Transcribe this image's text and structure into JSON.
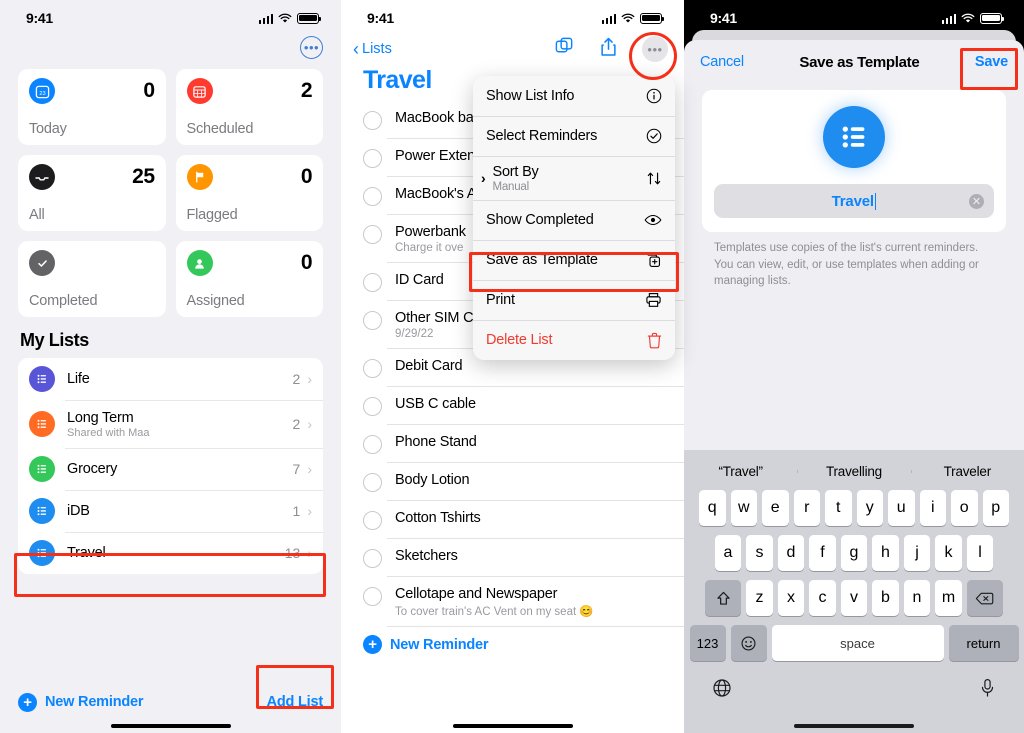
{
  "panel1": {
    "status": {
      "time": "9:41",
      "signal": "cellular-signal",
      "wifi": "wifi-icon",
      "battery": "battery-icon"
    },
    "more_button": "•••",
    "tiles": [
      {
        "label": "Today",
        "count": "0",
        "color": "#0a84ff",
        "icon": "calendar-today-icon",
        "glyph": "▦"
      },
      {
        "label": "Scheduled",
        "count": "2",
        "color": "#ff3b30",
        "icon": "calendar-scheduled-icon",
        "glyph": "▦"
      },
      {
        "label": "All",
        "count": "25",
        "color": "#1c1c1e",
        "icon": "tray-all-icon",
        "glyph": "▤"
      },
      {
        "label": "Flagged",
        "count": "0",
        "color": "#ff9500",
        "icon": "flag-icon",
        "glyph": "⚑"
      },
      {
        "label": "Completed",
        "count": "",
        "color": "#636366",
        "icon": "checkmark-circle-icon",
        "glyph": "✓"
      },
      {
        "label": "Assigned",
        "count": "0",
        "color": "#34c759",
        "icon": "person-icon",
        "glyph": "●"
      }
    ],
    "section_title": "My Lists",
    "lists": [
      {
        "name": "Life",
        "sub": "",
        "count": "2",
        "color": "#5856d6"
      },
      {
        "name": "Long Term",
        "sub": "Shared with Maa",
        "count": "2",
        "color": "#ff6b22"
      },
      {
        "name": "Grocery",
        "sub": "",
        "count": "7",
        "color": "#34c759"
      },
      {
        "name": "iDB",
        "sub": "",
        "count": "1",
        "color": "#1f8cf0"
      },
      {
        "name": "Travel",
        "sub": "",
        "count": "13",
        "color": "#1f8cf0"
      }
    ],
    "new_reminder": "New Reminder",
    "add_list": "Add List"
  },
  "panel2": {
    "status": {
      "time": "9:41"
    },
    "back_label": "Lists",
    "title": "Travel",
    "nav_icons": [
      {
        "name": "copy-icon"
      },
      {
        "name": "share-icon"
      },
      {
        "name": "more-ellipsis-icon",
        "glyph": "•••"
      }
    ],
    "reminders": [
      {
        "title": "MacBook ba",
        "note": ""
      },
      {
        "title": "Power Exten",
        "note": ""
      },
      {
        "title": "MacBook's A",
        "note": ""
      },
      {
        "title": "Powerbank",
        "note": "Charge it ove"
      },
      {
        "title": "ID Card",
        "note": ""
      },
      {
        "title": "Other SIM C",
        "note": "9/29/22"
      },
      {
        "title": "Debit Card",
        "note": ""
      },
      {
        "title": "USB C cable",
        "note": ""
      },
      {
        "title": "Phone Stand",
        "note": ""
      },
      {
        "title": "Body Lotion",
        "note": ""
      },
      {
        "title": "Cotton Tshirts",
        "note": ""
      },
      {
        "title": "Sketchers",
        "note": ""
      },
      {
        "title": "Cellotape and Newspaper",
        "note": "To cover train's AC Vent on my seat 😊"
      }
    ],
    "new_reminder": "New Reminder",
    "menu": [
      {
        "label": "Show List Info",
        "sublabel": "",
        "icon": "info-circle-icon",
        "glyph": "ⓘ",
        "danger": false,
        "submenu": false
      },
      {
        "label": "Select Reminders",
        "sublabel": "",
        "icon": "checkmark-circle-icon",
        "glyph": "⊘",
        "danger": false,
        "submenu": false
      },
      {
        "label": "Sort By",
        "sublabel": "Manual",
        "icon": "sort-arrows-icon",
        "glyph": "⇅",
        "danger": false,
        "submenu": true
      },
      {
        "label": "Show Completed",
        "sublabel": "",
        "icon": "eye-icon",
        "glyph": "◉",
        "danger": false,
        "submenu": false
      },
      {
        "label": "Save as Template",
        "sublabel": "",
        "icon": "template-plus-icon",
        "glyph": "⊞",
        "danger": false,
        "submenu": false
      },
      {
        "label": "Print",
        "sublabel": "",
        "icon": "printer-icon",
        "glyph": "⎙",
        "danger": false,
        "submenu": false
      },
      {
        "label": "Delete List",
        "sublabel": "",
        "icon": "trash-icon",
        "glyph": "🗑",
        "danger": true,
        "submenu": false
      }
    ]
  },
  "panel3": {
    "status": {
      "time": "9:41"
    },
    "cancel": "Cancel",
    "title": "Save as Template",
    "save": "Save",
    "list_icon": "list-bullet-icon",
    "name_value": "Travel",
    "clear_icon": "clear-text-icon",
    "help_text": "Templates use copies of the list's current reminders. You can view, edit, or use templates when adding or managing lists.",
    "keyboard": {
      "suggestions": [
        "“Travel”",
        "Travelling",
        "Traveler"
      ],
      "row1": [
        "q",
        "w",
        "e",
        "r",
        "t",
        "y",
        "u",
        "i",
        "o",
        "p"
      ],
      "row2": [
        "a",
        "s",
        "d",
        "f",
        "g",
        "h",
        "j",
        "k",
        "l"
      ],
      "row3": [
        "z",
        "x",
        "c",
        "v",
        "b",
        "n",
        "m"
      ],
      "shift": "⇧",
      "backspace": "⌫",
      "numbers": "123",
      "emoji": "☺",
      "space": "space",
      "return": "return",
      "globe": "globe-icon",
      "mic": "microphone-icon"
    }
  }
}
